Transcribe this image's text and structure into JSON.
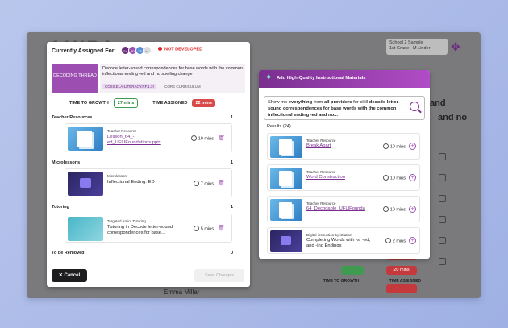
{
  "background": {
    "logo": "AMIRA",
    "school": "School 2 Sample",
    "grade": "1st Grade - M Linder",
    "right_text_1": "and",
    "right_text_2": "and no",
    "bottom_name": "Emma Millar",
    "bottom_label_1": "TIME TO GROWTH",
    "bottom_label_2": "TIME ASSIGNED",
    "pill_1": "20 mins"
  },
  "left_modal": {
    "title": "Currently Assigned For:",
    "avatars": [
      "GA",
      "JD",
      "TS",
      "+1"
    ],
    "status": "NOT DEVELOPED",
    "thread_label": "DECODING THREAD",
    "thread_desc": "Decode letter-sound correspondences for base words with the common inflectional ending -ed and no spelling change",
    "standard_tag": "CCSS.ELA-LITERACY.RF.1.3f",
    "core_label": "CORE CURRICULUM",
    "time_to_growth_label": "TIME TO GROWTH",
    "time_to_growth_value": "27 mins",
    "time_assigned_label": "TIME ASSIGNED",
    "time_assigned_value": "22 mins",
    "sections": [
      {
        "title": "Teacher Resources",
        "count": "1",
        "item": {
          "type": "Teacher Resource",
          "title": "Lesson_64_-ed_UFLIFoundations.pptx",
          "mins": "10 mins"
        }
      },
      {
        "title": "Microlessons",
        "count": "1",
        "item": {
          "type": "Microlesson",
          "title": "Inflectional Ending: ED",
          "mins": "7 mins"
        }
      },
      {
        "title": "Tutoring",
        "count": "1",
        "item": {
          "type": "Targeted Amira Tutoring",
          "title": "Tutoring in Decode letter-sound correspondences for base...",
          "mins": "5 mins"
        }
      },
      {
        "title": "To be Removed",
        "count": "0"
      }
    ],
    "cancel_label": "Cancel",
    "save_label": "Save Changes"
  },
  "right_modal": {
    "title": "Add High-Quality Instructional Materials",
    "search": {
      "prefix": "Show me",
      "bold1": "everything",
      "mid": "from",
      "bold2": "all providers",
      "suffix": "for skill",
      "skill": "decode letter-sound correspondences for base words with the common inflectional ending -ed and no..."
    },
    "results_label": "Results (24)",
    "results": [
      {
        "type": "Teacher Resource",
        "title": "Break Apart",
        "mins": "10 mins",
        "thumb": "doc",
        "link": true
      },
      {
        "type": "Teacher Resource",
        "title": "Word Construction",
        "mins": "10 mins",
        "thumb": "doc",
        "link": true
      },
      {
        "type": "Teacher Resource",
        "title": "64_Decodable_UFLIFounda",
        "mins": "10 mins",
        "thumb": "doc",
        "link": true
      },
      {
        "type": "Digital instruction by iStation",
        "title": "Completing Words with -s, -ed, and -ing Endings",
        "mins": "2 mins",
        "thumb": "vid",
        "link": false
      }
    ]
  }
}
